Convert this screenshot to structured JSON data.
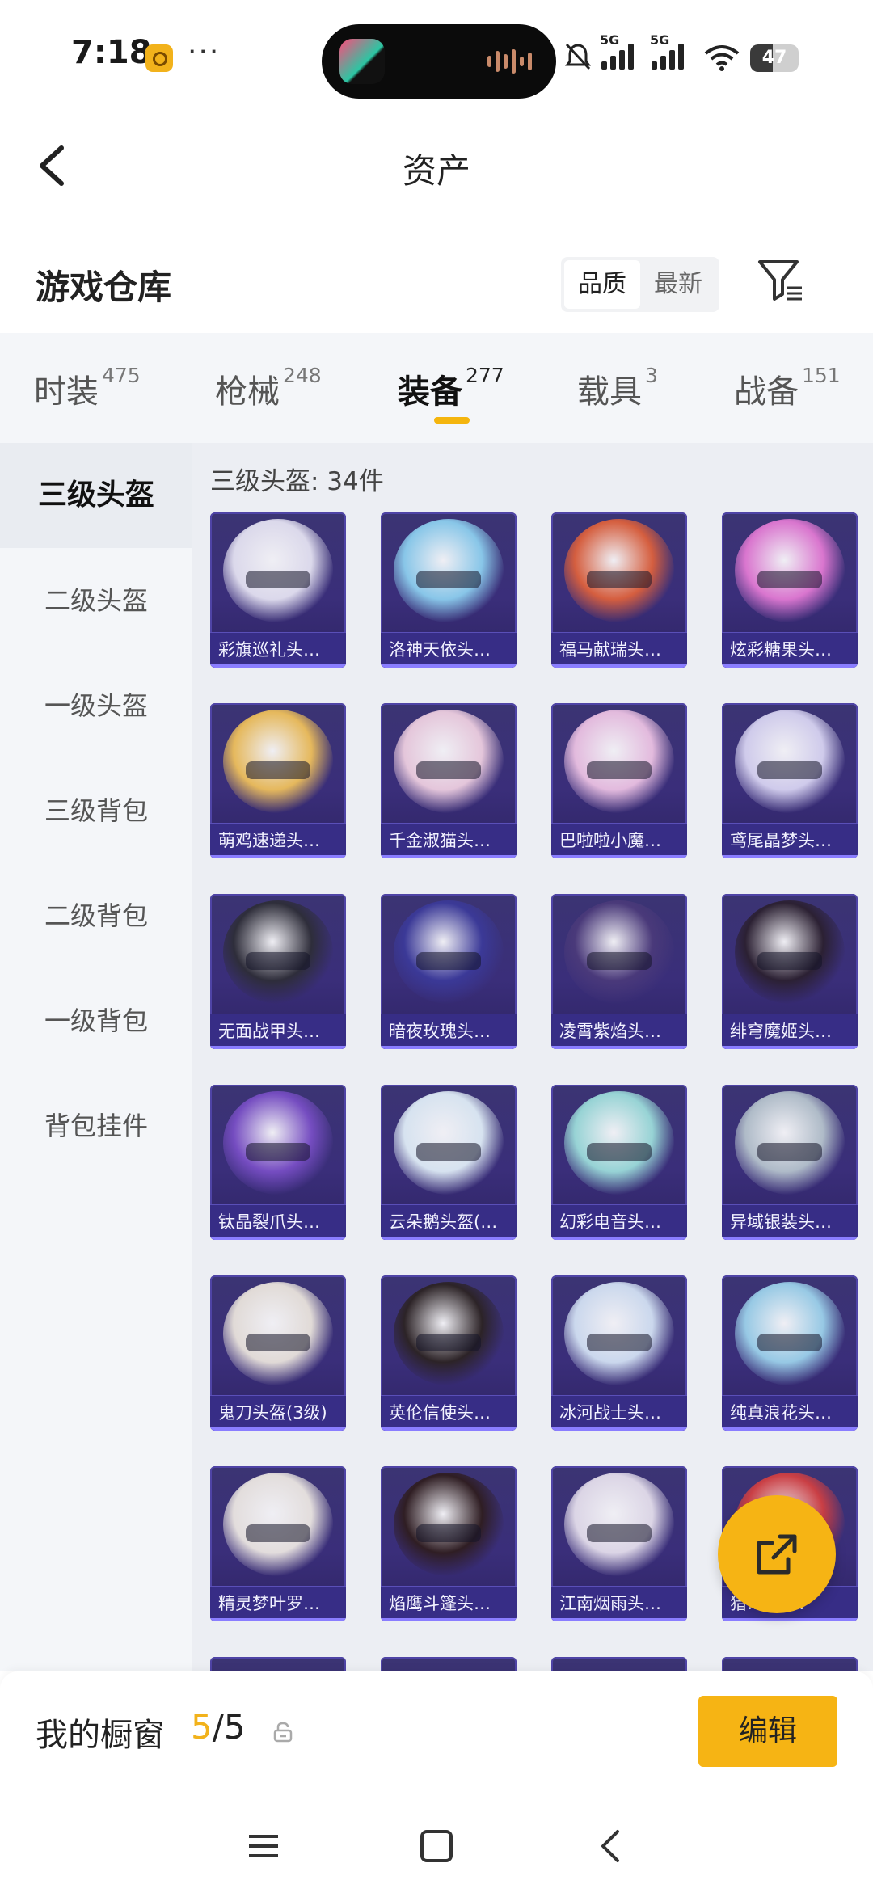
{
  "status_bar": {
    "time": "7:18",
    "more": "···",
    "signal1_label": "5G",
    "signal2_label": "5G",
    "battery": "47",
    "battery_level": 0.47
  },
  "header": {
    "title": "资产",
    "back_icon": "chevron-left-icon"
  },
  "warehouse": {
    "title": "游戏仓库",
    "sort_options": [
      "品质",
      "最新"
    ],
    "sort_selected": "品质",
    "filter_icon": "filter-icon"
  },
  "tabs": [
    {
      "label": "时装",
      "count": "475",
      "active": false
    },
    {
      "label": "枪械",
      "count": "248",
      "active": false
    },
    {
      "label": "装备",
      "count": "277",
      "active": true
    },
    {
      "label": "载具",
      "count": "3",
      "active": false
    },
    {
      "label": "战备",
      "count": "151",
      "active": false
    }
  ],
  "sidebar": {
    "items": [
      "三级头盔",
      "二级头盔",
      "一级头盔",
      "三级背包",
      "二级背包",
      "一级背包",
      "背包挂件"
    ],
    "active_index": 0
  },
  "grid": {
    "title": "三级头盔: 34件",
    "items": [
      {
        "name": "彩旗巡礼头…",
        "color": "#e9e7f5"
      },
      {
        "name": "洛神天依头…",
        "color": "#8fd3f2"
      },
      {
        "name": "福马献瑞头…",
        "color": "#e2623a"
      },
      {
        "name": "炫彩糖果头…",
        "color": "#e77cd6"
      },
      {
        "name": "萌鸡速递头…",
        "color": "#f4c45a"
      },
      {
        "name": "千金淑猫头…",
        "color": "#f3d3e3"
      },
      {
        "name": "巴啦啦小魔…",
        "color": "#f1c6e6"
      },
      {
        "name": "鸢尾晶梦头…",
        "color": "#dcd8f5"
      },
      {
        "name": "无面战甲头…",
        "color": "#2d2d35"
      },
      {
        "name": "暗夜玫瑰头…",
        "color": "#3b3a9a"
      },
      {
        "name": "凌霄紫焰头…",
        "color": "#4b3a7a"
      },
      {
        "name": "绯穹魔姬头…",
        "color": "#2a1f2d"
      },
      {
        "name": "钛晶裂爪头…",
        "color": "#7a4fc7"
      },
      {
        "name": "云朵鹅头盔(…",
        "color": "#e4f2fa"
      },
      {
        "name": "幻彩电音头…",
        "color": "#9fe1dd"
      },
      {
        "name": "异域银装头…",
        "color": "#b9c7cf"
      },
      {
        "name": "鬼刀头盔(3级)",
        "color": "#efe9df"
      },
      {
        "name": "英伦信使头…",
        "color": "#2b2220"
      },
      {
        "name": "冰河战士头…",
        "color": "#d7e6f7"
      },
      {
        "name": "纯真浪花头…",
        "color": "#9fd6ee"
      },
      {
        "name": "精灵梦叶罗…",
        "color": "#f1ece5"
      },
      {
        "name": "焰鹰斗篷头…",
        "color": "#2e1c1c"
      },
      {
        "name": "江南烟雨头…",
        "color": "#e9e3ef"
      },
      {
        "name": "猎…盔(…",
        "color": "#d64040"
      }
    ]
  },
  "showcase": {
    "label": "我的橱窗",
    "used": "5",
    "separator": "/",
    "total": "5",
    "lock_icon": "lock-icon",
    "edit_label": "编辑"
  },
  "fab": {
    "icon": "share-icon"
  },
  "navbar": {
    "icons": [
      "menu-icon",
      "home-icon",
      "back-icon"
    ]
  }
}
